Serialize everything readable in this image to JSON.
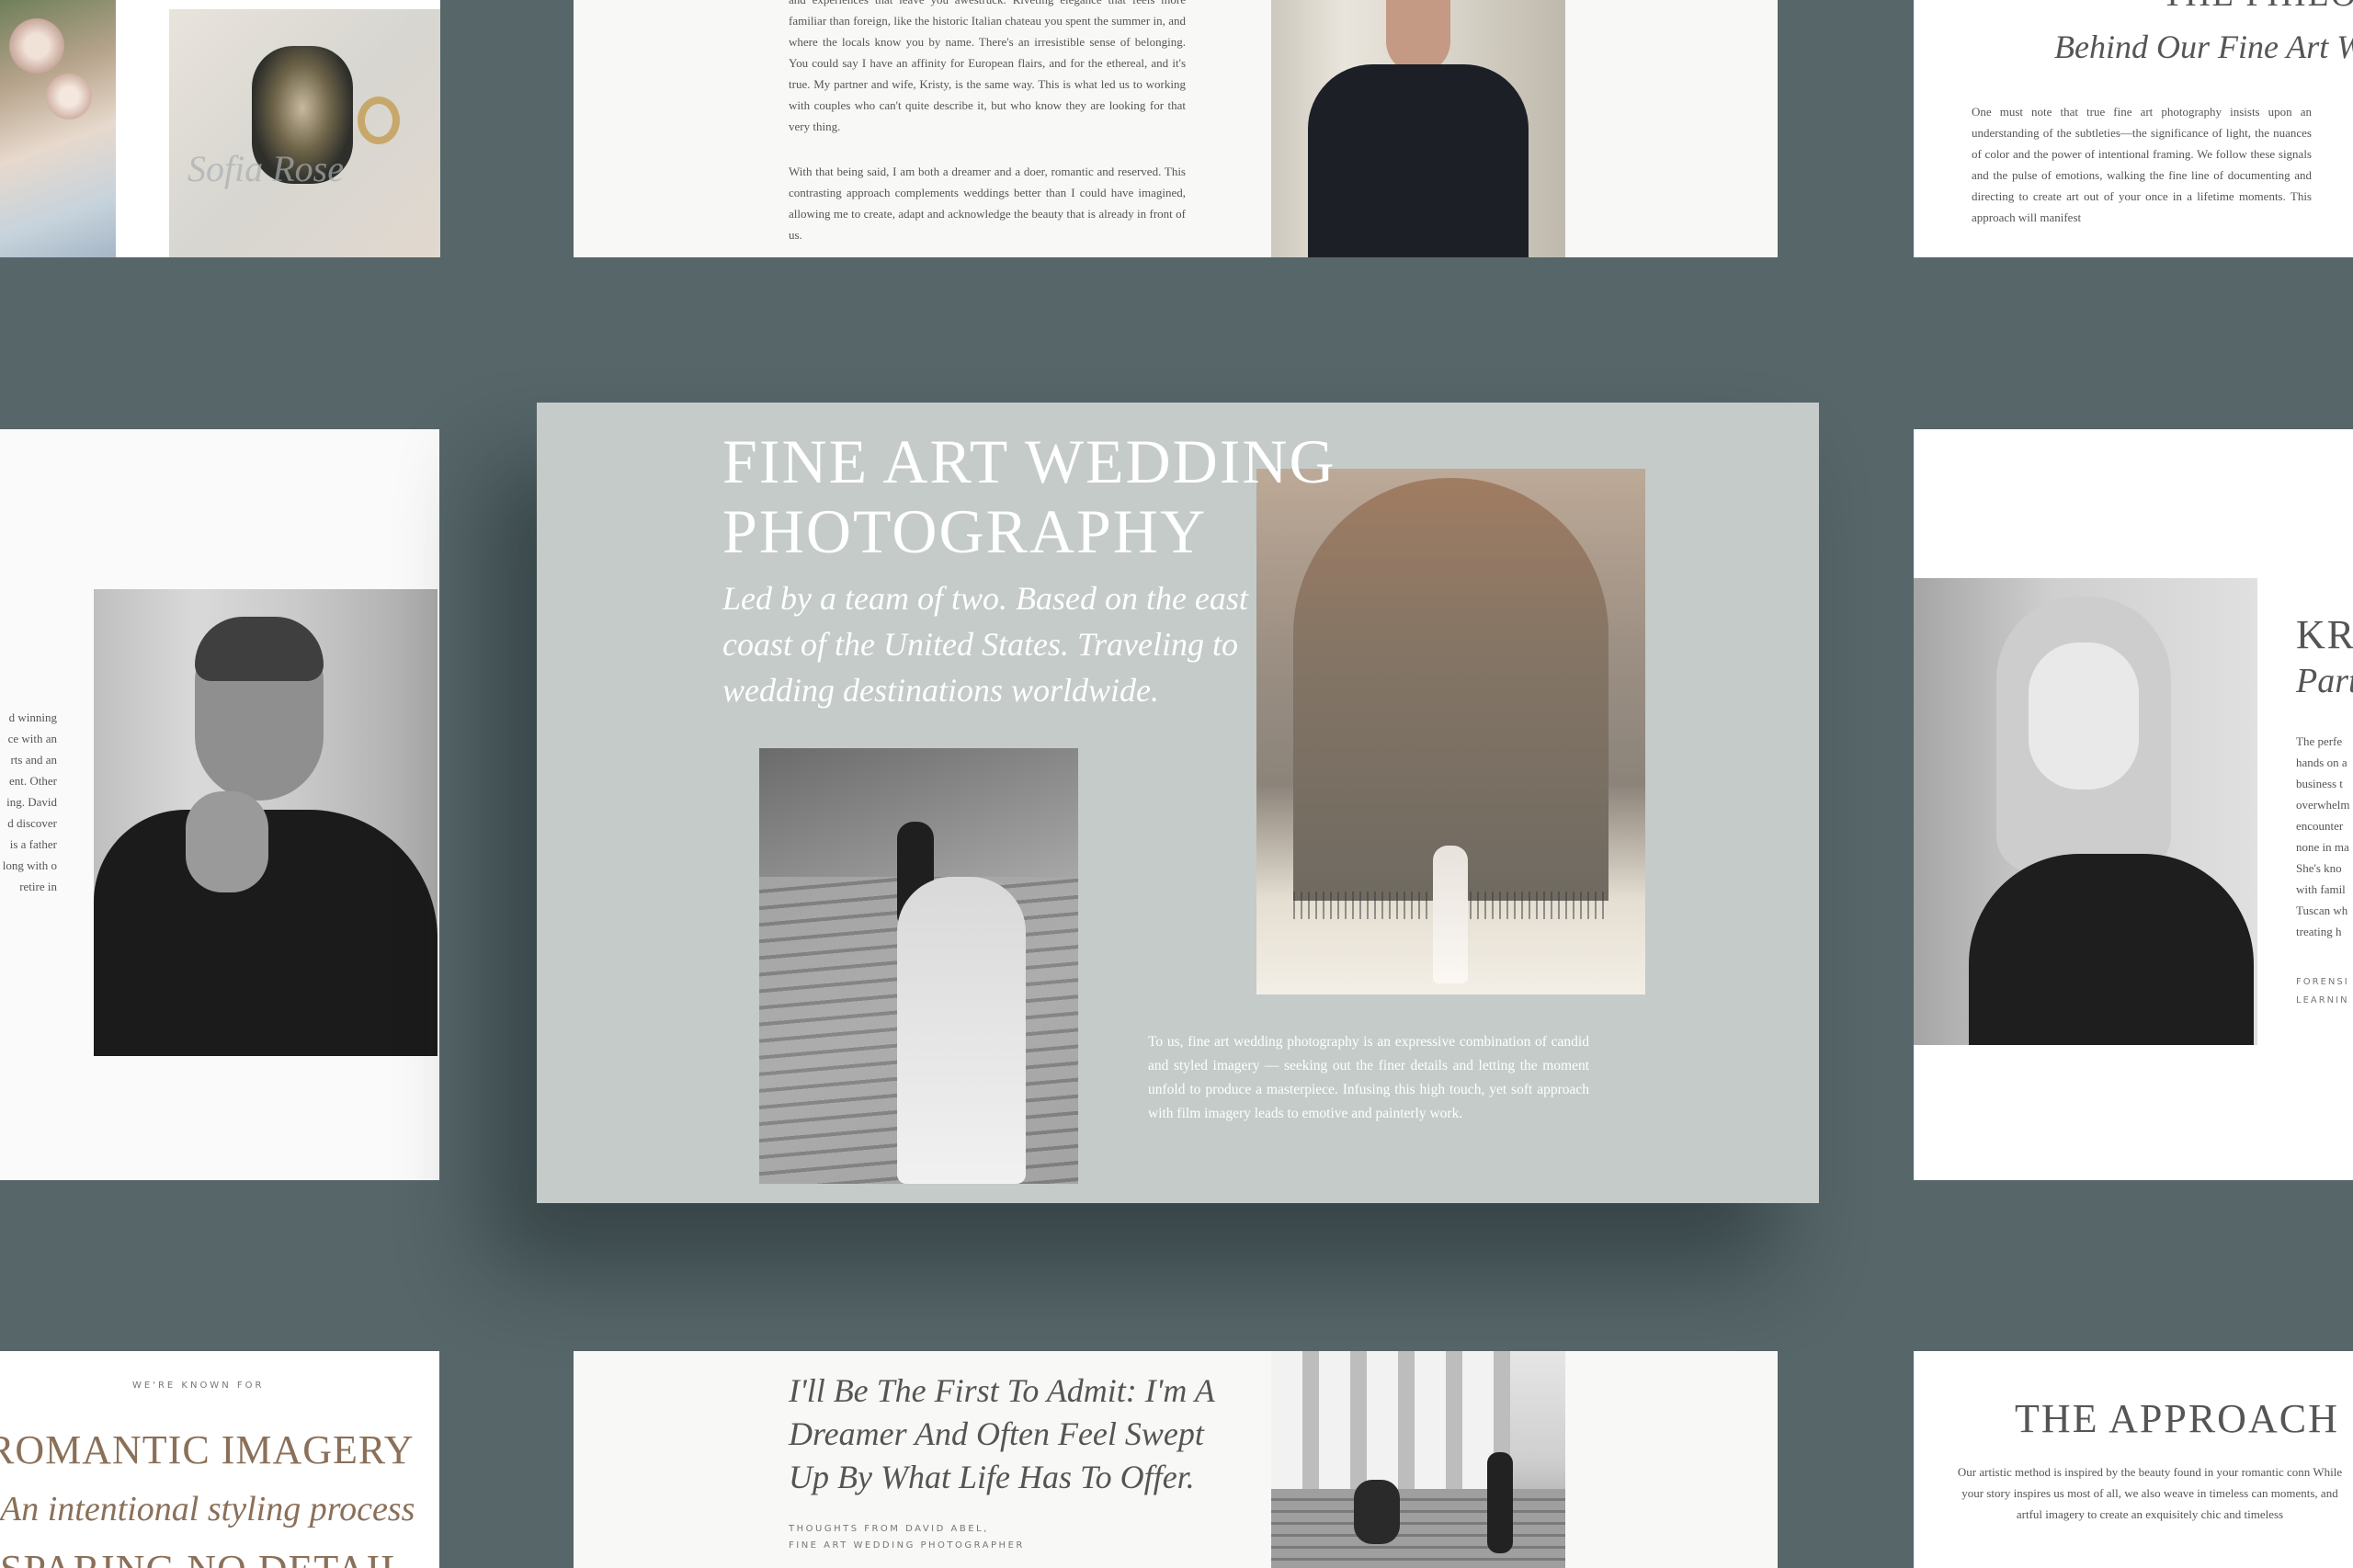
{
  "top_left": {
    "ring_box_script": "Sofia Rose"
  },
  "top_middle": {
    "para1": "and experiences that leave you awestruck. Riveting elegance that feels more familiar than foreign, like the historic Italian chateau you spent the summer in, and where the locals know you by name. There's an irresistible sense of belonging. You could say I have an affinity for European flairs, and for the ethereal, and it's true. My partner and wife, Kristy, is the same way. This is what led us to working with couples who can't quite describe it, but who know they are looking for that very thing.",
    "para2": "With that being said, I am both a dreamer and a doer, romantic and reserved. This contrasting approach complements weddings better than I could have imagined, allowing me to create, adapt and acknowledge the beauty that is already in front of us."
  },
  "top_right": {
    "title": "THE PHILO",
    "subtitle": "Behind Our Fine Art W",
    "body": "One must note that true fine art photography insists upon an understanding of the subtleties—the significance of light, the nuances of color and the power of intentional framing. We follow these signals and the pulse of emotions, walking the fine line of documenting and directing to create art out of your once in a lifetime moments. This approach will manifest"
  },
  "middle_left": {
    "body": "d winning ce with an rts and an ent. Other ing. David d discover is a father long with o retire in"
  },
  "hero": {
    "title_line1": "FINE ART WEDDING",
    "title_line2": "PHOTOGRAPHY",
    "subtitle": "Led by a team of two. Based on the east coast of the United States. Traveling to wedding destinations worldwide.",
    "body": "To us, fine art wedding photography is an expressive combination of candid and styled imagery — seeking out the finer details and letting the moment unfold to produce a masterpiece. Infusing this high touch, yet soft approach with film imagery leads to emotive and painterly work."
  },
  "middle_right": {
    "name": "KR",
    "role": "Part",
    "body": "The perfe hands on a business t overwhelm encounter none in ma She's kno with famil Tuscan wh treating h",
    "footer_line1": "FORENSI",
    "footer_line2": "LEARNIN"
  },
  "bottom_left": {
    "kicker": "WE'RE KNOWN FOR",
    "heading": "ROMANTIC IMAGERY",
    "subheading": "An intentional styling process",
    "heading2": "SPARING NO DETAIL"
  },
  "bottom_middle": {
    "quote": "I'll Be The First To Admit: I'm A Dreamer And Often Feel Swept Up By What Life Has To Offer.",
    "credit_line1": "THOUGHTS FROM DAVID ABEL,",
    "credit_line2": "FINE ART WEDDING PHOTOGRAPHER"
  },
  "bottom_right": {
    "title": "THE APPROACH",
    "body": "Our artistic method is inspired by the beauty found in your romantic conn While your story inspires us most of all, we also weave in timeless can moments, and artful imagery to create an exquisitely chic and timeless"
  }
}
